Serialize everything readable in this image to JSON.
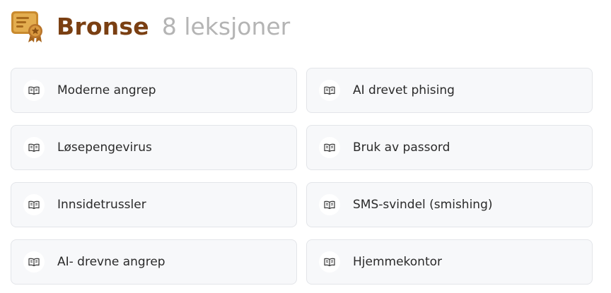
{
  "header": {
    "title": "Bronse",
    "count_label": "8 leksjoner",
    "badge_icon": "certificate-ribbon-icon"
  },
  "colors": {
    "title": "#7a3f12",
    "count": "#b4b4b4",
    "card_background": "#f7f8fa",
    "card_border": "#e3e5e9",
    "badge": "#c98a2e"
  },
  "lessons": [
    {
      "label": "Moderne angrep",
      "icon": "open-book-icon"
    },
    {
      "label": "AI drevet phising",
      "icon": "open-book-icon"
    },
    {
      "label": "Løsepengevirus",
      "icon": "open-book-icon"
    },
    {
      "label": "Bruk av passord",
      "icon": "open-book-icon"
    },
    {
      "label": "Innsidetrussler",
      "icon": "open-book-icon"
    },
    {
      "label": "SMS-svindel (smishing)",
      "icon": "open-book-icon"
    },
    {
      "label": "AI- drevne angrep",
      "icon": "open-book-icon"
    },
    {
      "label": "Hjemmekontor",
      "icon": "open-book-icon"
    }
  ]
}
